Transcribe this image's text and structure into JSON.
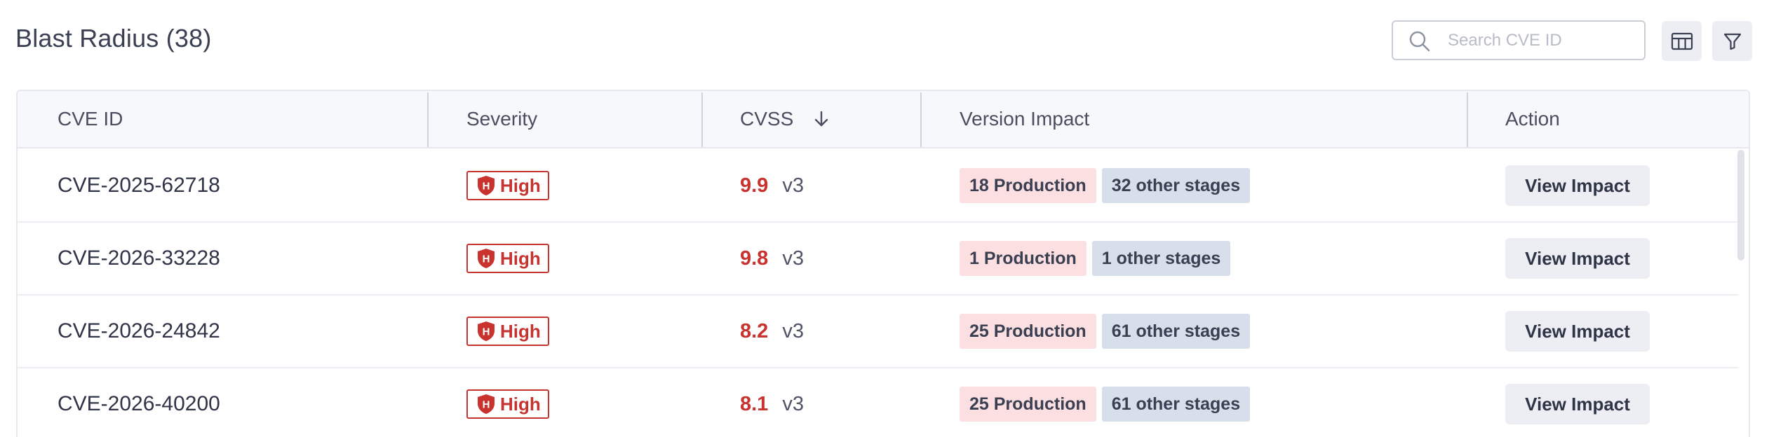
{
  "header": {
    "title": "Blast Radius (38)",
    "search_placeholder": "Search CVE ID",
    "icons": {
      "search": "search-icon",
      "columns": "columns-icon",
      "filter": "filter-icon"
    }
  },
  "table": {
    "columns": [
      "CVE ID",
      "Severity",
      "CVSS",
      "Version Impact",
      "Action"
    ],
    "sort_icon": "arrow-down-icon",
    "rows": [
      {
        "cve_id": "CVE-2025-62718",
        "severity": "High",
        "severity_letter": "H",
        "cvss": "9.9",
        "version": "v3",
        "production": "18 Production",
        "other": "32 other stages",
        "action": "View Impact"
      },
      {
        "cve_id": "CVE-2026-33228",
        "severity": "High",
        "severity_letter": "H",
        "cvss": "9.8",
        "version": "v3",
        "production": "1 Production",
        "other": "1 other stages",
        "action": "View Impact"
      },
      {
        "cve_id": "CVE-2026-24842",
        "severity": "High",
        "severity_letter": "H",
        "cvss": "8.2",
        "version": "v3",
        "production": "25 Production",
        "other": "61 other stages",
        "action": "View Impact"
      },
      {
        "cve_id": "CVE-2026-40200",
        "severity": "High",
        "severity_letter": "H",
        "cvss": "8.1",
        "version": "v3",
        "production": "25 Production",
        "other": "61 other stages",
        "action": "View Impact"
      }
    ]
  },
  "colors": {
    "high": "#c8322f",
    "production_tag": "#fbdfe1",
    "other_tag": "#d6dfea",
    "button": "#eceef4"
  }
}
